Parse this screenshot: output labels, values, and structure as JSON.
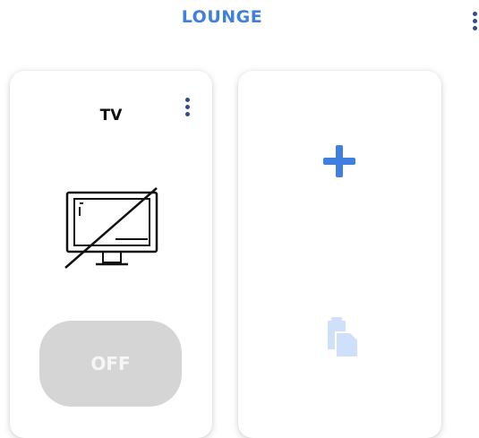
{
  "header": {
    "title": "LOUNGE",
    "menu_icon": "more-vertical-icon"
  },
  "devices": [
    {
      "name": "TV",
      "icon": "tv-off-icon",
      "menu_icon": "more-vertical-icon",
      "state_label": "OFF"
    }
  ],
  "add_card": {
    "add_icon": "plus-icon",
    "paste_icon": "paste-icon"
  },
  "colors": {
    "accent": "#3f7fe0",
    "menu_dots": "#2f4f86",
    "off_button_bg": "#d5d5d5",
    "off_button_text": "#f6f6f6",
    "paste_icon": "#cfe0fa"
  }
}
